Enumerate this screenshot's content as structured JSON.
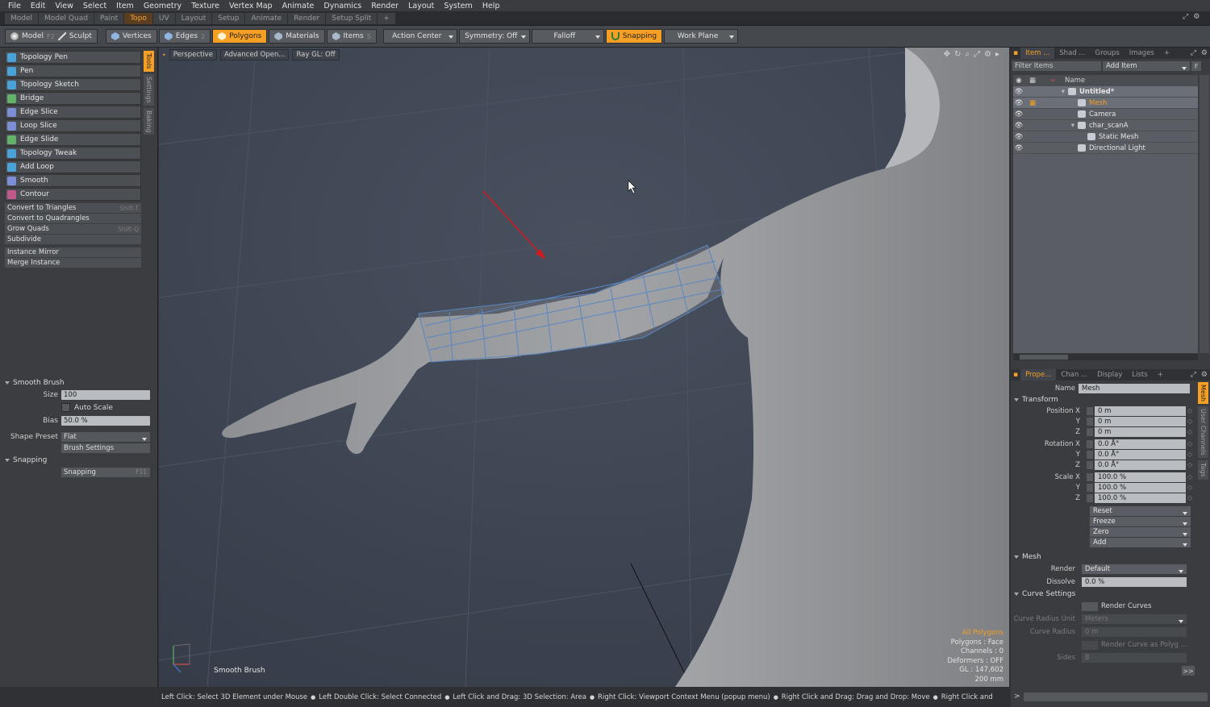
{
  "menu": [
    "File",
    "Edit",
    "View",
    "Select",
    "Item",
    "Geometry",
    "Texture",
    "Vertex Map",
    "Animate",
    "Dynamics",
    "Render",
    "Layout",
    "System",
    "Help"
  ],
  "layout_tabs": [
    {
      "label": "Model",
      "active": false
    },
    {
      "label": "Model Quad",
      "active": false
    },
    {
      "label": "Paint",
      "active": false
    },
    {
      "label": "Topo",
      "active": true
    },
    {
      "label": "UV",
      "active": false
    },
    {
      "label": "Layout",
      "active": false
    },
    {
      "label": "Setup",
      "active": false
    },
    {
      "label": "Animate",
      "active": false
    },
    {
      "label": "Render",
      "active": false
    },
    {
      "label": "Setup Split",
      "active": false
    },
    {
      "label": "+",
      "active": false
    }
  ],
  "toolbar": {
    "model": "Model",
    "model_key": "F2",
    "sculpt": "Sculpt",
    "vertices": "Vertices",
    "edges": "Edges",
    "edges_key": "2",
    "polygons": "Polygons",
    "materials": "Materials",
    "items": "Items",
    "items_key": "5",
    "action_center": "Action Center",
    "symmetry": "Symmetry: Off",
    "falloff": "Falloff",
    "snapping": "Snapping",
    "work_plane": "Work Plane"
  },
  "tools": [
    {
      "label": "Topology Pen",
      "icon": "pen-icon",
      "color": "#4aa3d8"
    },
    {
      "label": "Pen",
      "icon": "pen-icon",
      "color": "#4aa3d8"
    },
    {
      "label": "Topology Sketch",
      "icon": "sketch-icon",
      "color": "#4aa3d8"
    },
    {
      "label": "Bridge",
      "icon": "bridge-icon",
      "color": "#62b26a"
    },
    {
      "label": "Edge Slice",
      "icon": "slice-icon",
      "color": "#7c8fd6"
    },
    {
      "label": "Loop Slice",
      "icon": "slice-icon",
      "color": "#7c8fd6"
    },
    {
      "label": "Edge Slide",
      "icon": "slide-icon",
      "color": "#62b26a"
    },
    {
      "label": "Topology Tweak",
      "icon": "tweak-icon",
      "color": "#4aa3d8"
    },
    {
      "label": "Add Loop",
      "icon": "loop-icon",
      "color": "#4aa3d8"
    },
    {
      "label": "Smooth",
      "icon": "smooth-icon",
      "color": "#7c8fd6"
    },
    {
      "label": "Contour",
      "icon": "contour-icon",
      "color": "#c05a8c"
    }
  ],
  "commands_a": [
    {
      "label": "Convert to Triangles",
      "key": "Shift-T"
    },
    {
      "label": "Convert to Quadrangles",
      "key": ""
    },
    {
      "label": "Grow Quads",
      "key": "Shift-Q"
    },
    {
      "label": "Subdivide",
      "key": ""
    }
  ],
  "commands_b": [
    {
      "label": "Instance Mirror"
    },
    {
      "label": "Merge Instance"
    }
  ],
  "side_tabs": [
    "Tools",
    "Settings",
    "Baking"
  ],
  "brush": {
    "section": "Smooth Brush",
    "size_label": "Size",
    "size": "100",
    "auto_scale": "Auto Scale",
    "bias_label": "Bias",
    "bias": "50.0 %",
    "shape_label": "Shape Preset",
    "shape": "Flat",
    "brush_settings": "Brush Settings",
    "snap_section": "Snapping",
    "snap_button": "Snapping",
    "snap_key": "F11"
  },
  "viewport": {
    "perspective": "Perspective",
    "advanced": "Advanced Open...",
    "raygl": "Ray GL: Off",
    "tool_name": "Smooth Brush",
    "stats": {
      "all": "All Polygons",
      "polygons": "Polygons : Face",
      "channels": "Channels : 0",
      "deformers": "Deformers : OFF",
      "gl": "GL : 147,602",
      "size": "200 mm"
    }
  },
  "status": [
    "Left Click: Select 3D Element under Mouse",
    "Left Double Click: Select Connected",
    "Left Click and Drag: 3D Selection: Area",
    "Right Click: Viewport Context Menu (popup menu)",
    "Right Click and Drag: Drag and Drop: Move",
    "Right Click and"
  ],
  "items_panel": {
    "tabs": [
      "Item ...",
      "Shad ...",
      "Groups",
      "Images",
      "+"
    ],
    "filter": "Filter Items",
    "add_item": "Add Item",
    "f_btn": "F",
    "name_col": "Name",
    "rows": [
      {
        "label": "Untitled*",
        "indent": 0,
        "selected": true
      },
      {
        "label": "Mesh",
        "indent": 1,
        "selected": true
      },
      {
        "label": "Camera",
        "indent": 1,
        "selected": false
      },
      {
        "label": "char_scanA",
        "indent": 1,
        "selected": false
      },
      {
        "label": "Static Mesh",
        "indent": 2,
        "selected": false
      },
      {
        "label": "Directional Light",
        "indent": 1,
        "selected": false
      }
    ]
  },
  "props": {
    "tabs": [
      "Prope...",
      "Chan ...",
      "Display",
      "Lists",
      "+"
    ],
    "side_tabs": [
      "Mesh",
      "User Channels",
      "Tags"
    ],
    "name_label": "Name",
    "name": "Mesh",
    "transform": "Transform",
    "pos_label": "Position X",
    "pos": [
      "0 m",
      "0 m",
      "0 m"
    ],
    "rot_label": "Rotation X",
    "rot": [
      "0.0 Å°",
      "0.0 Å°",
      "0.0 Å°"
    ],
    "scale_label": "Scale X",
    "scale": [
      "100.0 %",
      "100.0 %",
      "100.0 %"
    ],
    "y": "Y",
    "z": "Z",
    "buttons": [
      "Reset",
      "Freeze",
      "Zero",
      "Add"
    ],
    "mesh_sec": "Mesh",
    "render_label": "Render",
    "render": "Default",
    "dissolve_label": "Dissolve",
    "dissolve": "0.0 %",
    "curve_sec": "Curve Settings",
    "render_curves": "Render Curves",
    "cru_label": "Curve Radius Unit",
    "cru": "Meters",
    "cr_label": "Curve Radius",
    "cr": "0 m",
    "rcap": "Render Curve as Polyg ...",
    "sides_label": "Sides",
    "sides": "8",
    "more": ">>"
  }
}
